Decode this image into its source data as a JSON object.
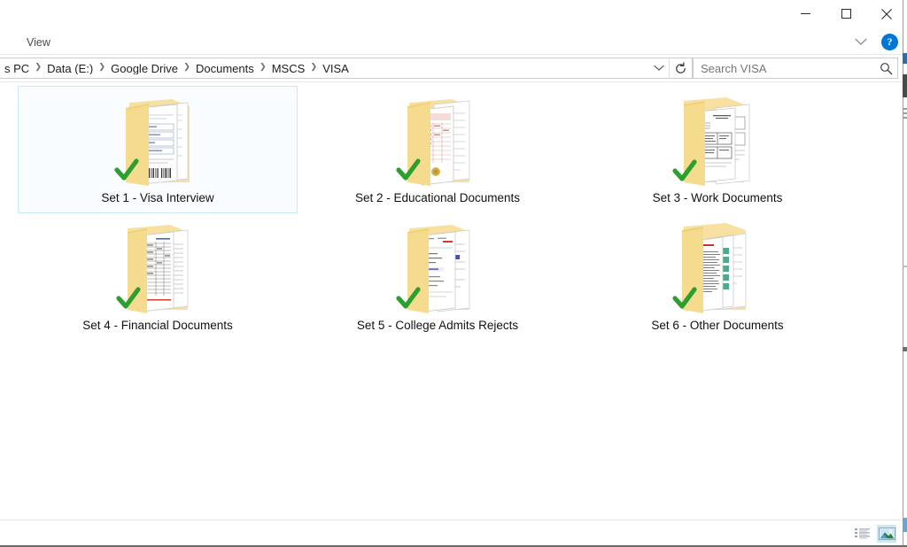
{
  "window": {
    "title": "",
    "controls": {
      "minimize_label": "Minimize",
      "maximize_label": "Maximize",
      "close_label": "Close"
    }
  },
  "ribbon": {
    "tabs": [
      {
        "label": "View",
        "active": true
      }
    ],
    "collapse_label": "Collapse the Ribbon",
    "help_label": "?"
  },
  "address": {
    "breadcrumbs": [
      {
        "label": "s PC"
      },
      {
        "label": "Data (E:)"
      },
      {
        "label": "Google Drive"
      },
      {
        "label": "Documents"
      },
      {
        "label": "MSCS"
      },
      {
        "label": "VISA"
      }
    ],
    "separator": "❯",
    "dropdown_icon": "chevron-down-icon",
    "refresh_icon": "refresh-icon"
  },
  "search": {
    "placeholder": "Search VISA",
    "value": "",
    "icon": "search-icon"
  },
  "files": {
    "items": [
      {
        "name": "Set 1 - Visa Interview",
        "type": "folder",
        "selected": true,
        "badge": "check-green",
        "doc_style": "form"
      },
      {
        "name": "Set 2 - Educational Documents",
        "type": "folder",
        "selected": false,
        "badge": "check-green",
        "doc_style": "marksheet"
      },
      {
        "name": "Set 3 - Work Documents",
        "type": "folder",
        "selected": false,
        "badge": "check-green",
        "doc_style": "letter"
      },
      {
        "name": "Set 4 - Financial Documents",
        "type": "folder",
        "selected": false,
        "badge": "check-green",
        "doc_style": "statement"
      },
      {
        "name": "Set 5 - College Admits Rejects",
        "type": "folder",
        "selected": false,
        "badge": "check-green",
        "doc_style": "email"
      },
      {
        "name": "Set 6 - Other Documents",
        "type": "folder",
        "selected": false,
        "badge": "check-green",
        "doc_style": "list"
      }
    ]
  },
  "statusbar": {
    "status_text": "",
    "views": [
      {
        "name": "details-view",
        "label": "Details view",
        "active": false
      },
      {
        "name": "large-icons-view",
        "label": "Large icons view",
        "active": true
      }
    ]
  },
  "colors": {
    "accent": "#0078d7",
    "folder_yellow": "#f5db8e",
    "folder_yellow_dark": "#e8c86a",
    "check_green": "#2e9e30",
    "selection_fill": "#fafdff",
    "selection_border": "#cde8f6",
    "text": "#111111"
  }
}
